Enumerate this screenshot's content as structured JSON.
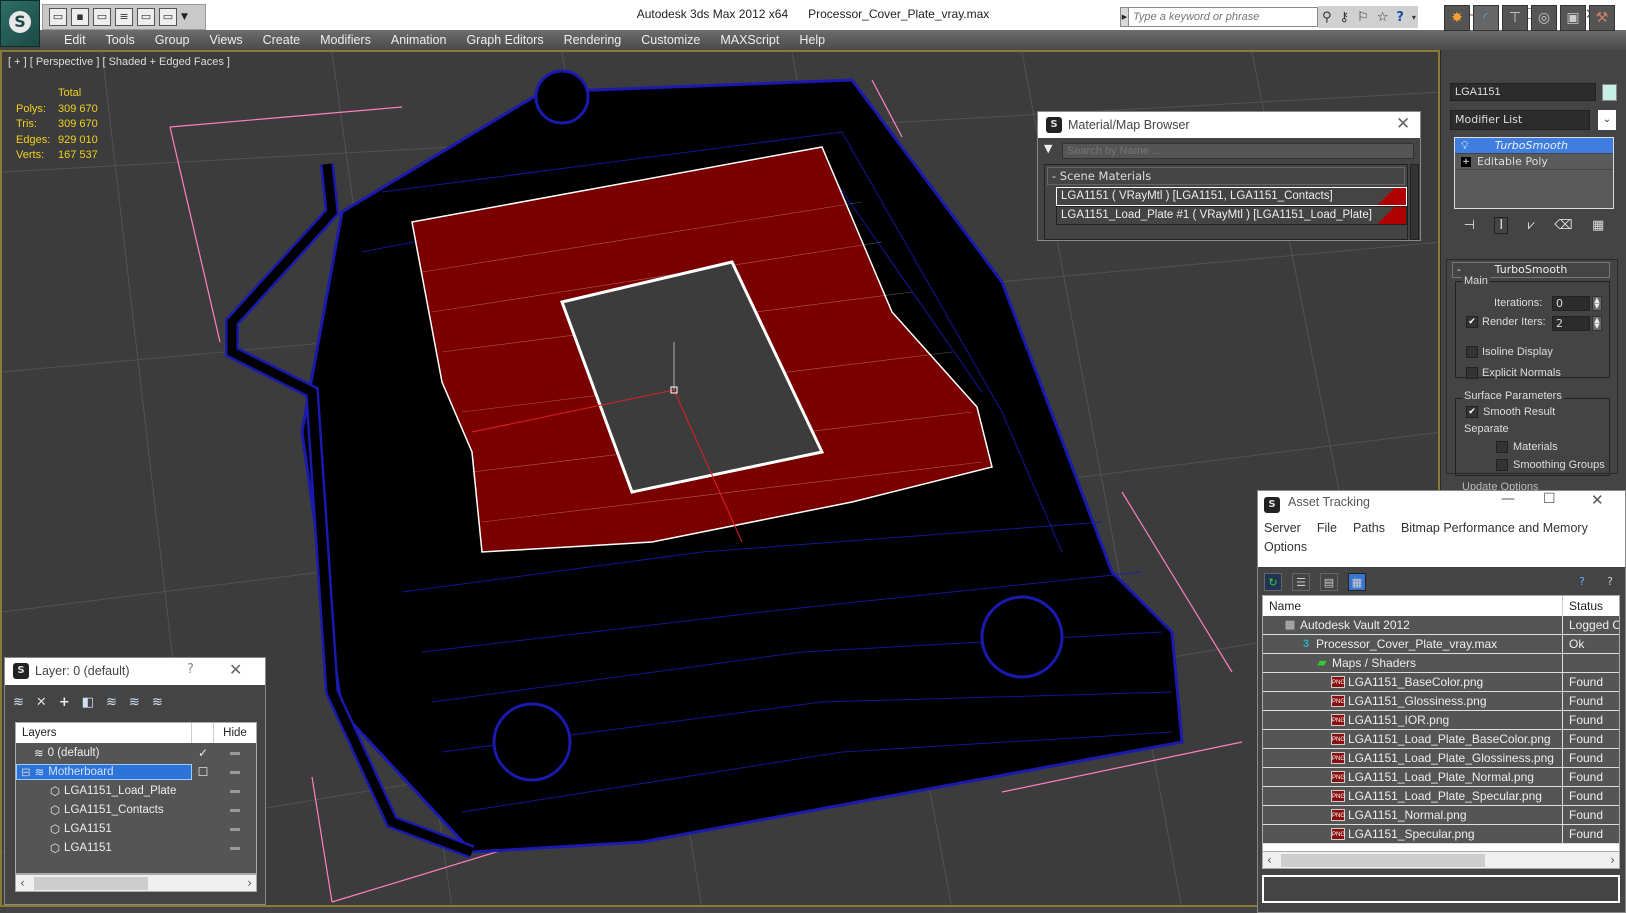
{
  "app": {
    "title": "Autodesk 3ds Max  2012 x64",
    "filename": "Processor_Cover_Plate_vray.max",
    "search_placeholder": "Type a keyword or phrase"
  },
  "menu": [
    "Edit",
    "Tools",
    "Group",
    "Views",
    "Create",
    "Modifiers",
    "Animation",
    "Graph Editors",
    "Rendering",
    "Customize",
    "MAXScript",
    "Help"
  ],
  "viewport": {
    "label": "[ + ] [ Perspective ] [ Shaded + Edged Faces ]",
    "stats_header": "Total",
    "stats": [
      {
        "key": "Polys:",
        "value": "309 670"
      },
      {
        "key": "Tris:",
        "value": "309 670"
      },
      {
        "key": "Edges:",
        "value": "929 010"
      },
      {
        "key": "Verts:",
        "value": "167 537"
      }
    ],
    "colors": {
      "wire": "#1a1ab0",
      "contacts": "#8b0000",
      "grid_pink": "#ff80c0",
      "bg": "#3c3c3c"
    }
  },
  "command_panel": {
    "object_name": "LGA1151",
    "object_color": "#c7efe6",
    "modifier_list": "Modifier List",
    "stack": [
      {
        "label": "TurboSmooth",
        "selected": true
      },
      {
        "label": "Editable Poly",
        "selected": false
      }
    ],
    "rollout": {
      "title": "TurboSmooth",
      "main_group": "Main",
      "iterations_label": "Iterations:",
      "iterations_value": "0",
      "render_iters_label": "Render Iters:",
      "render_iters_value": "2",
      "render_iters_checked": true,
      "isoline_label": "Isoline Display",
      "explicit_label": "Explicit Normals",
      "surface_group": "Surface Parameters",
      "smooth_result_label": "Smooth Result",
      "separate_label": "Separate",
      "materials_label": "Materials",
      "smoothing_groups_label": "Smoothing Groups",
      "update_options_label": "Update Options"
    }
  },
  "material_browser": {
    "title": "Material/Map Browser",
    "search_placeholder": "Search by Name ...",
    "section": "- Scene Materials",
    "materials": [
      "LGA1151  ( VRayMtl )  [LGA1151, LGA1151_Contacts]",
      "LGA1151_Load_Plate #1  ( VRayMtl )  [LGA1151_Load_Plate]"
    ]
  },
  "asset_tracking": {
    "title": "Asset Tracking",
    "menu": [
      "Server",
      "File",
      "Paths",
      "Bitmap Performance and Memory",
      "Options"
    ],
    "columns": [
      "Name",
      "Status"
    ],
    "rows": [
      {
        "name": "Autodesk Vault 2012",
        "status": "Logged O",
        "level": 1,
        "icon": "vault"
      },
      {
        "name": "Processor_Cover_Plate_vray.max",
        "status": "Ok",
        "level": 2,
        "icon": "max"
      },
      {
        "name": "Maps / Shaders",
        "status": "",
        "level": 3,
        "icon": "maps"
      },
      {
        "name": "LGA1151_BaseColor.png",
        "status": "Found",
        "level": 4,
        "icon": "png"
      },
      {
        "name": "LGA1151_Glossiness.png",
        "status": "Found",
        "level": 4,
        "icon": "png"
      },
      {
        "name": "LGA1151_IOR.png",
        "status": "Found",
        "level": 4,
        "icon": "png"
      },
      {
        "name": "LGA1151_Load_Plate_BaseColor.png",
        "status": "Found",
        "level": 4,
        "icon": "png"
      },
      {
        "name": "LGA1151_Load_Plate_Glossiness.png",
        "status": "Found",
        "level": 4,
        "icon": "png"
      },
      {
        "name": "LGA1151_Load_Plate_Normal.png",
        "status": "Found",
        "level": 4,
        "icon": "png"
      },
      {
        "name": "LGA1151_Load_Plate_Specular.png",
        "status": "Found",
        "level": 4,
        "icon": "png"
      },
      {
        "name": "LGA1151_Normal.png",
        "status": "Found",
        "level": 4,
        "icon": "png"
      },
      {
        "name": "LGA1151_Specular.png",
        "status": "Found",
        "level": 4,
        "icon": "png"
      }
    ]
  },
  "layer_dialog": {
    "title": "Layer: 0 (default)",
    "help": "?",
    "columns": [
      "Layers",
      "Hide"
    ],
    "rows": [
      {
        "name": "0 (default)",
        "level": 1,
        "type": "layer",
        "current": true,
        "selected": false
      },
      {
        "name": "Motherboard",
        "level": 0,
        "type": "layer",
        "current": false,
        "selected": true
      },
      {
        "name": "LGA1151_Load_Plate",
        "level": 2,
        "type": "object",
        "current": false,
        "selected": false
      },
      {
        "name": "LGA1151_Contacts",
        "level": 2,
        "type": "object",
        "current": false,
        "selected": false
      },
      {
        "name": "LGA1151",
        "level": 2,
        "type": "object",
        "current": false,
        "selected": false
      },
      {
        "name": "LGA1151",
        "level": 2,
        "type": "object",
        "current": false,
        "selected": false
      }
    ]
  }
}
